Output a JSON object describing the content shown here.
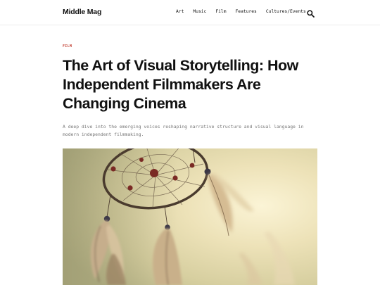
{
  "site": {
    "name": "Middle Mag"
  },
  "nav": {
    "items": [
      {
        "label": "Art"
      },
      {
        "label": "Music"
      },
      {
        "label": "Film"
      },
      {
        "label": "Features"
      },
      {
        "label": "Cultures/Events"
      }
    ],
    "search_icon": "search-icon"
  },
  "article": {
    "category": "FILM",
    "title": "The Art of Visual Storytelling: How Independent Filmmakers Are Changing Cinema",
    "subtitle": "A deep dive into the emerging voices reshaping narrative structure and visual language in modern independent filmmaking.",
    "hero_image_subject": "dreamcatcher"
  },
  "colors": {
    "accent": "#c0392b",
    "text": "#111111",
    "muted": "#777777",
    "divider": "#ececec"
  }
}
